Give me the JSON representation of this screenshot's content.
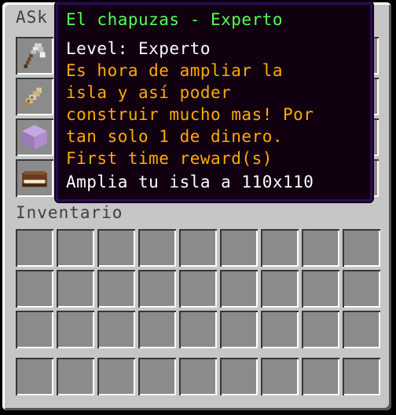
{
  "chest": {
    "title": "ASk"
  },
  "inventory": {
    "label": "Inventario"
  },
  "tooltip": {
    "name": "El chapuzas - Experto",
    "level": "Level: Experto",
    "description": [
      "Es hora de ampliar la",
      "isla y así poder",
      "construir mucho mas! Por",
      "tan solo 1 de dinero.",
      "First time reward(s)"
    ],
    "reward": "Amplia tu isla a 110x110"
  },
  "items": [
    {
      "name": "iron-axe-icon"
    },
    {
      "name": "name-tag-icon"
    },
    {
      "name": "purpur-block-icon"
    },
    {
      "name": "book-icon"
    }
  ],
  "colors": {
    "tooltip_name": "#55ff55",
    "tooltip_description": "#ffaa00",
    "tooltip_text": "#ffffff",
    "tooltip_background": "#100010",
    "tooltip_border": "#2a0a5e",
    "panel": "#c6c6c6",
    "slot": "#8b8b8b"
  }
}
